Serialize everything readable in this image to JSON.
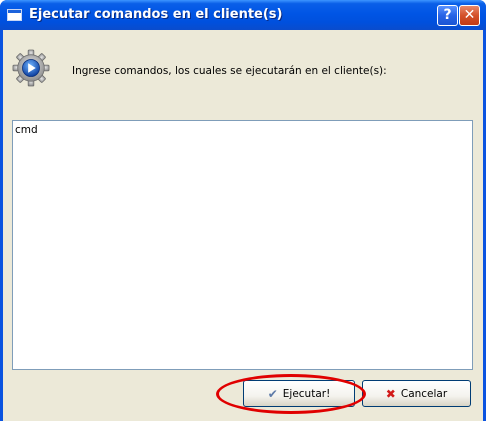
{
  "window": {
    "title": "Ejecutar comandos en el cliente(s)",
    "help_glyph": "?",
    "close_glyph": "✕"
  },
  "dialog": {
    "prompt": "Ingrese comandos, los cuales se ejecutarán en el cliente(s):",
    "command_value": "cmd",
    "icon": "gear-play-icon"
  },
  "buttons": {
    "ejecutar_label": "Ejecutar!",
    "ejecutar_icon": "✔",
    "cancelar_label": "Cancelar",
    "cancelar_icon": "✖"
  },
  "colors": {
    "titlebar": "#0055e5",
    "dialog_bg": "#ece9d8",
    "annotation": "#e00000"
  }
}
